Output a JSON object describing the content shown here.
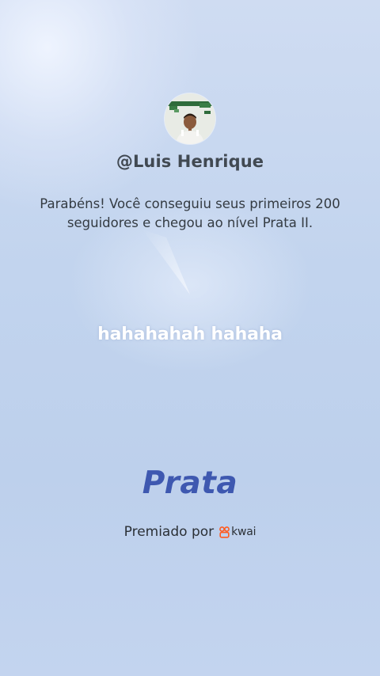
{
  "profile": {
    "username": "@Luis Henrique",
    "avatar_icon": "user-avatar-photo"
  },
  "achievement": {
    "message": "Parabéns! Você conseguiu seus primeiros 200 seguidores e chegou ao nível Prata II.",
    "level_title": "Prata",
    "level_color": "#3e58b0"
  },
  "overlay_caption": "hahahahah hahaha",
  "footer": {
    "awarded_by": "Premiado por",
    "brand_name": "kwai",
    "brand_color": "#ff5a1f",
    "brand_icon": "kwai-logo-icon"
  },
  "colors": {
    "background": "#c2d4ee",
    "text_primary": "#343b42"
  }
}
